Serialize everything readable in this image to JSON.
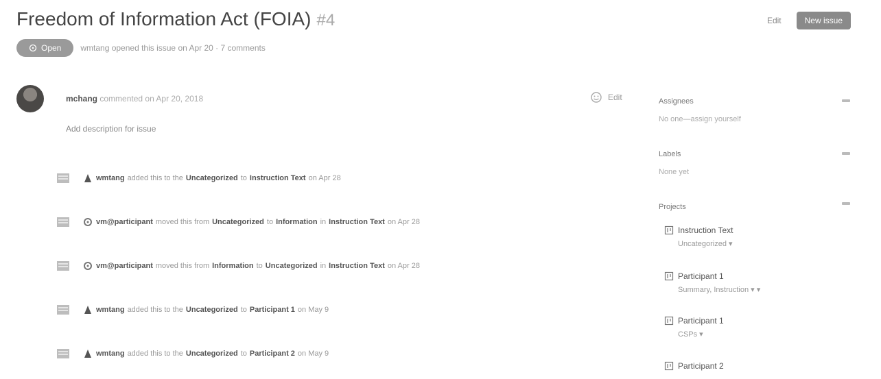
{
  "header": {
    "title": "Freedom of Information Act (FOIA)",
    "number": "#4",
    "edit_label": "Edit",
    "new_button_label": "New issue"
  },
  "meta": {
    "status_label": "Open",
    "summary": "wmtang opened this issue on Apr 20 · 7 comments"
  },
  "comment": {
    "author": "mchang",
    "subtitle": "commented on Apr 20, 2018",
    "body": "Add description for issue",
    "edit_label": "Edit"
  },
  "events": [
    {
      "actor": "wmtang",
      "actor_icon": "robot-icon",
      "text_a": "added this to the",
      "label_a": "Uncategorized",
      "text_b": "to",
      "label_b": "Instruction Text",
      "time": "on Apr 28"
    },
    {
      "actor": "vm@participant",
      "actor_icon": "gear-icon",
      "text_a": "moved this from",
      "label_a": "Uncategorized",
      "text_b": "to",
      "label_b": "Information",
      "text_c": "in",
      "label_c": "Instruction Text",
      "time": "on Apr 28"
    },
    {
      "actor": "vm@participant",
      "actor_icon": "gear-icon",
      "text_a": "moved this from",
      "label_a": "Information",
      "text_b": "to",
      "label_b": "Uncategorized",
      "text_c": "in",
      "label_c": "Instruction Text",
      "time": "on Apr 28"
    },
    {
      "actor": "wmtang",
      "actor_icon": "robot-icon",
      "text_a": "added this to the",
      "label_a": "Uncategorized",
      "text_b": "to",
      "label_b": "Participant 1",
      "time": "on May 9"
    },
    {
      "actor": "wmtang",
      "actor_icon": "robot-icon",
      "text_a": "added this to the",
      "label_a": "Uncategorized",
      "text_b": "to",
      "label_b": "Participant 2",
      "time": "on May 9"
    }
  ],
  "sidebar": {
    "assignees_label": "Assignees",
    "assignees_value": "No one—assign yourself",
    "labels_label": "Labels",
    "labels_value": "None yet",
    "projects_label": "Projects",
    "projects": [
      {
        "name": "Instruction Text",
        "value": "Uncategorized ▾"
      },
      {
        "name": "Participant 1",
        "value": "Summary, Instruction   ▾ ▾"
      },
      {
        "name": "Participant 1",
        "value": "CSPs ▾"
      },
      {
        "name": "Participant 2",
        "value": ""
      }
    ]
  },
  "colors": {
    "primary_button": "#8a8a8a",
    "status_pill": "#9a9a9a"
  }
}
